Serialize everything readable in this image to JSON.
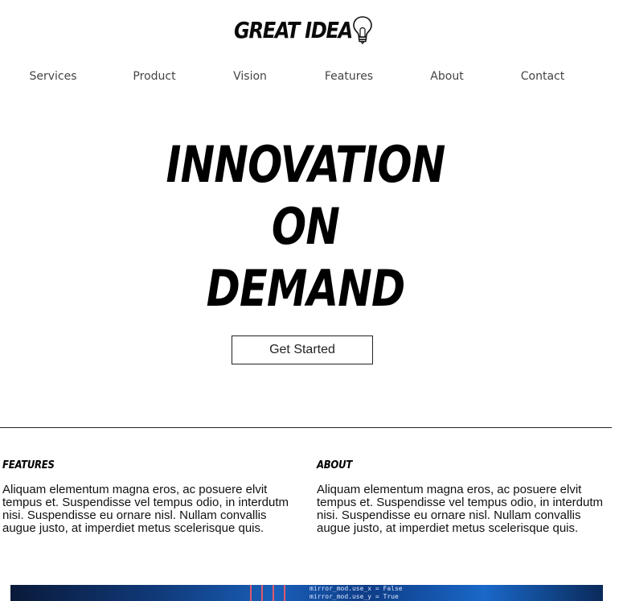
{
  "logo": {
    "text": "GREAT IDEA",
    "icon": "lightbulb-icon"
  },
  "nav": {
    "items": [
      "Services",
      "Product",
      "Vision",
      "Features",
      "About",
      "Contact"
    ]
  },
  "hero": {
    "line1": "INNOVATION",
    "line2": "ON",
    "line3": "DEMAND",
    "cta_label": "Get Started"
  },
  "features": {
    "heading": "FEATURES",
    "body": "Aliquam elementum magna eros, ac posuere elvit tempus et. Suspendisse vel tempus odio, in interdutm nisi. Suspendisse eu ornare nisl. Nullam convallis augue justo, at imperdiet metus scelerisque quis."
  },
  "about": {
    "heading": "ABOUT",
    "body": "Aliquam elementum magna eros, ac posuere elvit tempus et. Suspendisse vel tempus odio, in interdutm nisi. Suspendisse eu ornare nisl. Nullam convallis augue justo, at imperdiet metus scelerisque quis."
  },
  "banner": {
    "code_line1": "mirror_mod.use_x = False",
    "code_line2": "mirror_mod.use_y = True"
  },
  "colors": {
    "text": "#111111",
    "nav_text": "#444444",
    "banner_blue": "#1a5fb8"
  }
}
